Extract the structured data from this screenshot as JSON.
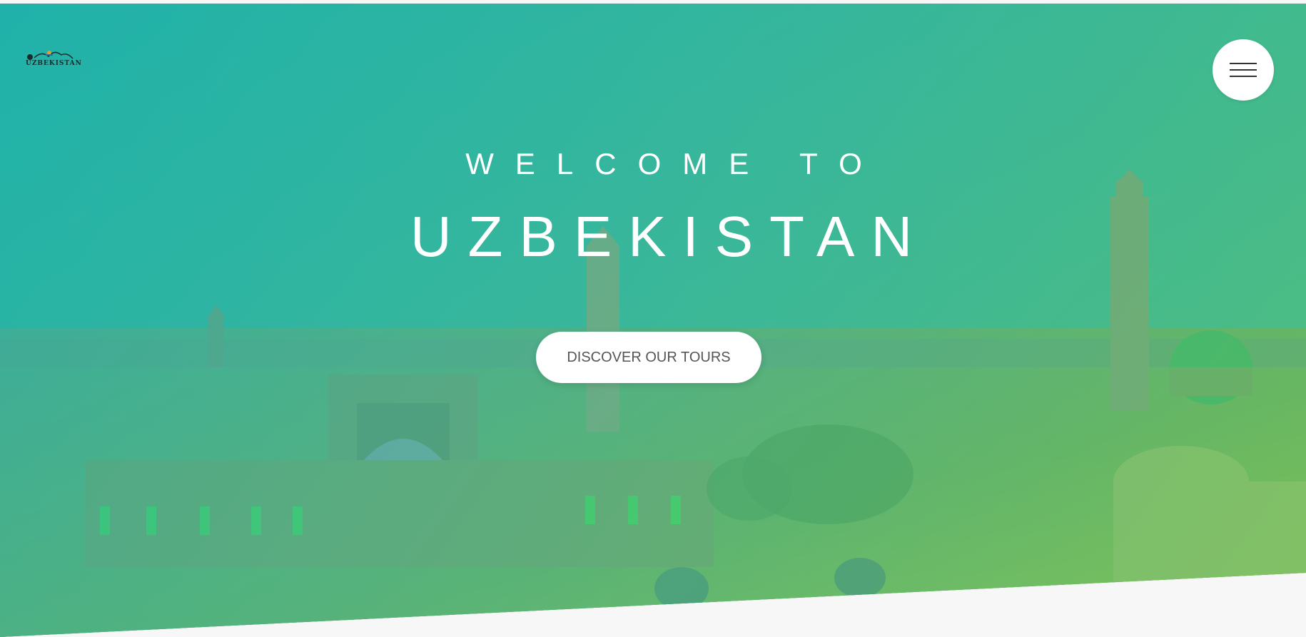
{
  "header": {
    "logo_text": "UZBEKISTAN",
    "menu_icon": "hamburger-menu-icon"
  },
  "hero": {
    "welcome": "WELCOME TO",
    "country": "UZBEKISTAN",
    "cta_label": "DISCOVER OUR TOURS"
  },
  "colors": {
    "gradient_start": "#23b0a9",
    "gradient_end": "#86c860",
    "button_bg": "#ffffff",
    "button_text": "#555555",
    "page_bg": "#f7f7f7"
  }
}
